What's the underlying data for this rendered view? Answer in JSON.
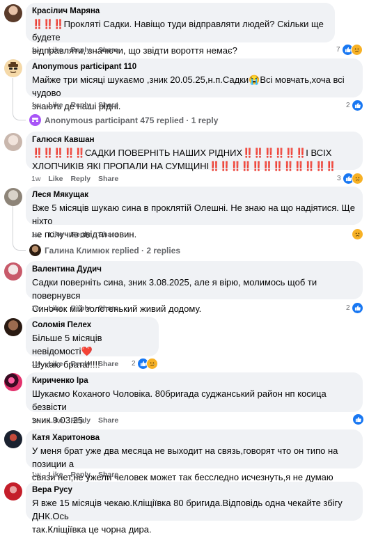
{
  "comments": [
    {
      "author": "Красілич Маряна",
      "line1": "Прокляті Садки. Навіщо туди відправляти людей? Скільки ще будете",
      "line2": "відправляти, значючи, що звідти вороття немає?",
      "prefix": "‼️‼️‼️",
      "time": "1w",
      "like": "Like",
      "reply": "Reply",
      "share": "Share",
      "react_count": "7",
      "reactions": [
        "like",
        "sad"
      ]
    },
    {
      "author": "Anonymous participant 110",
      "line1": "Майже три місяці шукаємо ,зник 20.05.25,н.п.Садки😭Всі мовчать,хоча всі чудово",
      "line2": "знають де наші рідні.",
      "time": "1w",
      "like": "Like",
      "reply": "Reply",
      "share": "Share",
      "react_count": "2",
      "reactions": [
        "like"
      ],
      "replies_label": "Anonymous participant 475 replied · 1 reply"
    },
    {
      "author": "Галюся Кавшан",
      "line1_prefix": "‼️‼️‼️‼️‼️",
      "line1": "САДКИ ПОВЕРНІТЬ НАШИХ РІДНИХ",
      "line1_mid": "‼️‼️‼️‼️‼️‼️",
      "line1_end": "І ВСІХ",
      "line2": "ХЛОПЧИКІВ ЯКІ ПРОПАЛИ НА СУМЩИНІ",
      "line2_suffix": "‼️‼️‼️‼️‼️‼️‼️‼️‼️‼️‼️‼️",
      "time": "1w",
      "like": "Like",
      "reply": "Reply",
      "share": "Share",
      "react_count": "3",
      "reactions": [
        "like",
        "sad"
      ]
    },
    {
      "author": "Леся Мякущак",
      "line1": "Вже 5 місяців шукаю сина в проклятій Олешні. Не знаю на що надіятися. Ще ніхто",
      "line2": "не получив звідти новин.",
      "time": "1w",
      "like": "Like",
      "reply": "Reply",
      "share": "Share",
      "react_count": "",
      "reactions": [
        "sad"
      ],
      "replies_label": "Галина Климюк replied · 2 replies"
    },
    {
      "author": "Валентина Дудич",
      "line1": "Садки поверніть сина, зник 3.08.2025, але я вірю, молимось щоб ти повернувся",
      "line2": "Синочок мій золотенький живий додому.",
      "time": "1w",
      "like": "Like",
      "reply": "Reply",
      "share": "Share",
      "react_count": "2",
      "reactions": [
        "like"
      ]
    },
    {
      "author": "Соломія Пелех",
      "line1": "Більше 5 місяців невідомості❤️",
      "line2": "Шукаю брата!!!!!",
      "time": "1w",
      "like": "Like",
      "reply": "Reply",
      "share": "Share",
      "react_count": "2",
      "reactions": [
        "like",
        "sad"
      ]
    },
    {
      "author": "Кириченко Іра",
      "line1": "Шукаємо Коханого Чоловіка. 80бригада суджанський район нп косица безвісти",
      "line2": "зник 9.03.25.",
      "time": "1w",
      "like": "Like",
      "reply": "Reply",
      "share": "Share",
      "react_count": "",
      "reactions": [
        "like"
      ]
    },
    {
      "author": "Катя Харитонова",
      "line1": "У меня брат уже два месяца не выходит на связь,говорят что он типо на позиции а",
      "line2": "связи нет,не ужели человек может так бесследно исчезнуть,я не думаю",
      "time": "1w",
      "like": "Like",
      "reply": "Reply",
      "share": "Share",
      "react_count": "",
      "reactions": []
    },
    {
      "author": "Вера Русу",
      "line1": "Я вже 15 місяців чекаю.Кліщіївка 80 бригида.Відповідь одна чекайте збігу ДНК.Ось",
      "line2": "так.Кліщіївка це чорна дира.",
      "time": "",
      "like": "",
      "reply": "",
      "share": "",
      "react_count": "",
      "reactions": []
    }
  ],
  "colors": {
    "bubble": "#f0f2f5",
    "like_blue": "#1877f2",
    "sad_yellow": "#f7b125",
    "meta_gray": "#65676b"
  }
}
